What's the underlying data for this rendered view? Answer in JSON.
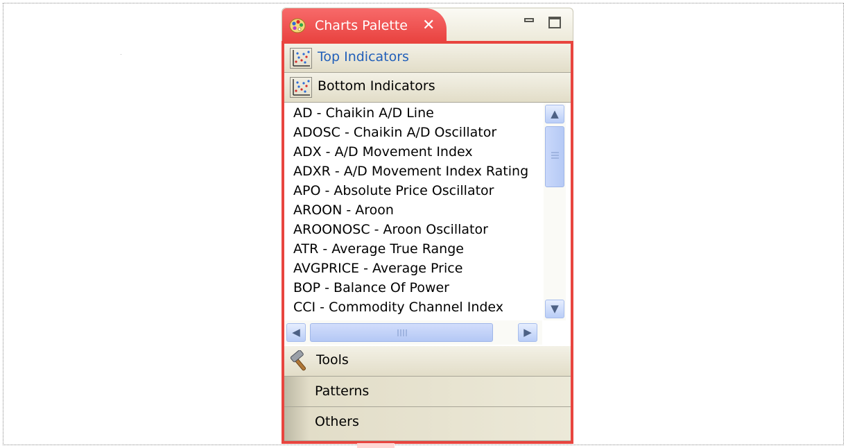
{
  "view": {
    "title": "Charts Palette",
    "close_symbol": "✕",
    "minimize_icon": "minimize-icon",
    "maximize_icon": "maximize-icon",
    "accent_color": "#e8453f"
  },
  "palette": {
    "drawers": {
      "top": {
        "label": "Top Indicators",
        "icon": "indicator-chart-icon",
        "state": "collapsed",
        "color": "#215fb9"
      },
      "bottom": {
        "label": "Bottom Indicators",
        "icon": "indicator-chart-icon",
        "state": "expanded"
      },
      "tools": {
        "label": "Tools",
        "icon": "hammer-icon"
      },
      "patterns": {
        "label": "Patterns"
      },
      "others": {
        "label": "Others"
      }
    },
    "bottom_indicator_items": [
      "AD - Chaikin A/D Line",
      "ADOSC - Chaikin A/D Oscillator",
      "ADX - A/D Movement Index",
      "ADXR - A/D Movement Index Rating",
      "APO - Absolute Price Oscillator",
      "AROON - Aroon",
      "AROONOSC - Aroon Oscillator",
      "ATR - Average True Range",
      "AVGPRICE - Average Price",
      "BOP - Balance Of Power",
      "CCI - Commodity Channel Index"
    ],
    "scrollbars": {
      "up_arrow": "▲",
      "down_arrow": "▼",
      "left_arrow": "◀",
      "right_arrow": "▶"
    }
  }
}
